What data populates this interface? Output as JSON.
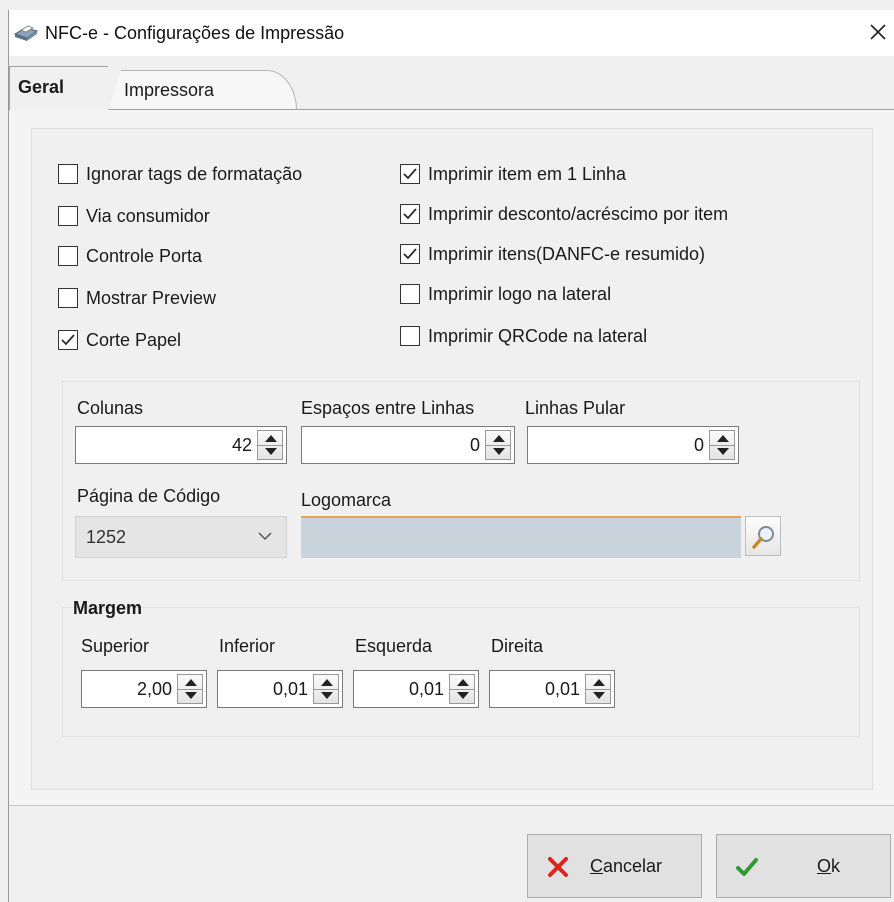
{
  "window": {
    "title": "NFC-e - Configurações de Impressão"
  },
  "tabs": [
    {
      "label": "Geral",
      "active": true
    },
    {
      "label": "Impressora",
      "active": false
    }
  ],
  "options_left": [
    {
      "label": "Ignorar tags de formatação",
      "checked": false
    },
    {
      "label": "Via consumidor",
      "checked": false
    },
    {
      "label": "Controle Porta",
      "checked": false
    },
    {
      "label": "Mostrar Preview",
      "checked": false
    },
    {
      "label": "Corte Papel",
      "checked": true
    }
  ],
  "options_right": [
    {
      "label": "Imprimir item em 1 Linha",
      "checked": true
    },
    {
      "label": "Imprimir desconto/acréscimo por item",
      "checked": true
    },
    {
      "label": "Imprimir itens(DANFC-e resumido)",
      "checked": true
    },
    {
      "label": "Imprimir logo na lateral",
      "checked": false
    },
    {
      "label": "Imprimir QRCode na lateral",
      "checked": false
    }
  ],
  "layout_fields": {
    "colunas": {
      "label": "Colunas",
      "value": "42"
    },
    "espacos": {
      "label": "Espaços entre Linhas",
      "value": "0"
    },
    "linhas_pular": {
      "label": "Linhas Pular",
      "value": "0"
    },
    "pagina_codigo": {
      "label": "Página de Código",
      "value": "1252"
    },
    "logomarca": {
      "label": "Logomarca",
      "value": ""
    }
  },
  "margem": {
    "title": "Margem",
    "superior": {
      "label": "Superior",
      "value": "2,00"
    },
    "inferior": {
      "label": "Inferior",
      "value": "0,01"
    },
    "esquerda": {
      "label": "Esquerda",
      "value": "0,01"
    },
    "direita": {
      "label": "Direita",
      "value": "0,01"
    }
  },
  "buttons": {
    "cancel": {
      "accel": "C",
      "rest": "ancelar"
    },
    "ok": {
      "accel": "O",
      "rest": "k"
    }
  },
  "colors": {
    "check_mark": "#2a2a2a",
    "cancel_x": "#d9261c",
    "ok_check": "#2e9b2e",
    "logo_bg": "#c9d4dd",
    "logo_accent": "#f0a04a"
  }
}
